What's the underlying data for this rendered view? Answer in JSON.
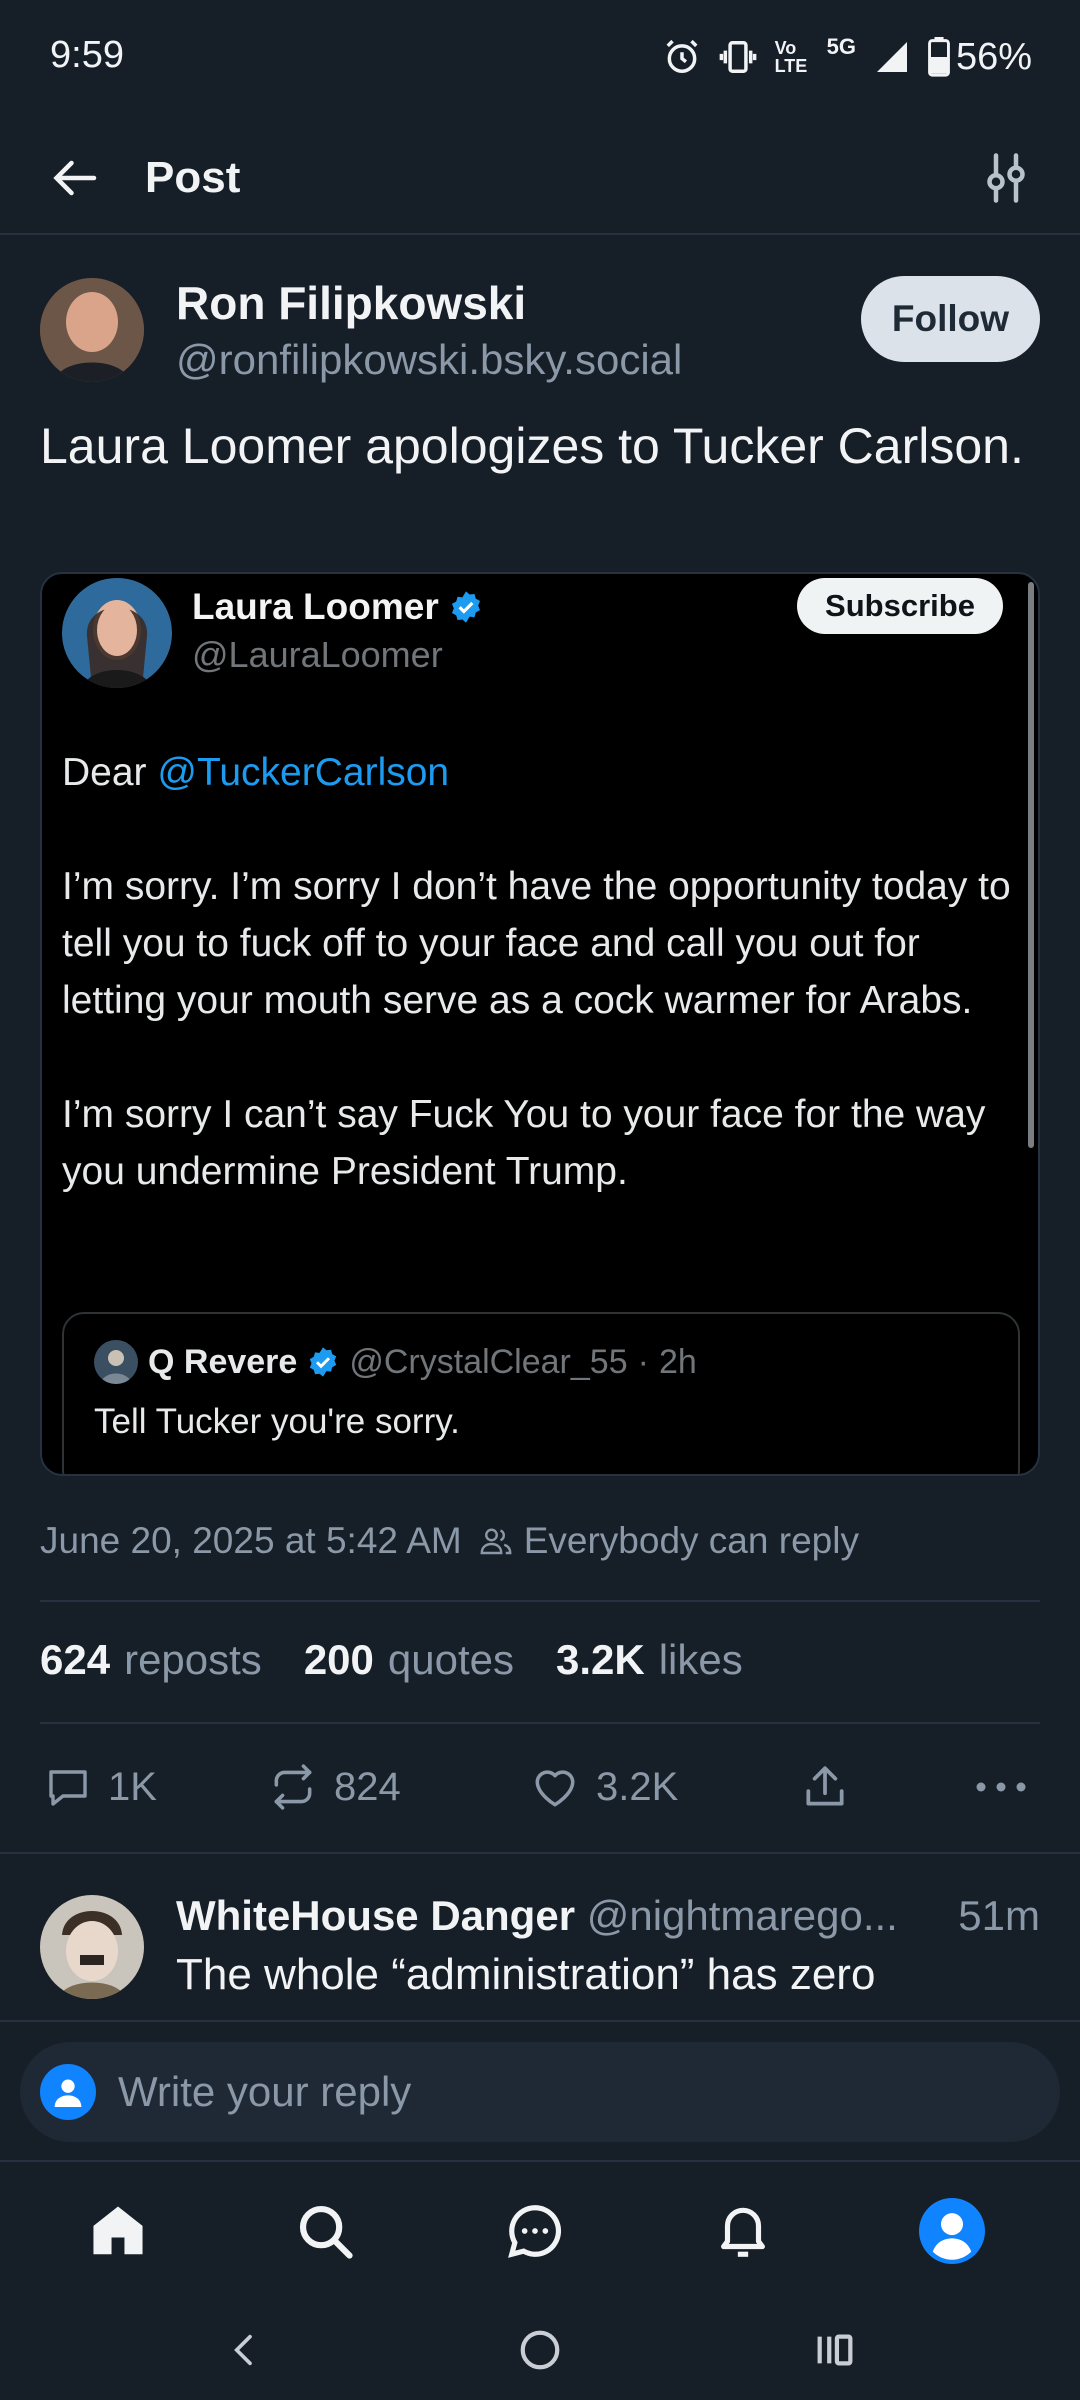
{
  "status_bar": {
    "time": "9:59",
    "network": "5G",
    "volte": "Vo LTE",
    "battery": "56%",
    "icons": [
      "alarm-icon",
      "vibrate-icon",
      "volte-icon",
      "signal-icon",
      "battery-icon"
    ]
  },
  "header": {
    "title": "Post",
    "back_icon": "arrow-left-icon",
    "filter_icon": "sliders-icon"
  },
  "post": {
    "author_name": "Ron Filipkowski",
    "author_handle": "@ronfilipkowski.bsky.social",
    "follow_label": "Follow",
    "text": "Laura Loomer apologizes to Tucker Carlson.",
    "embed": {
      "name": "Laura Loomer",
      "handle": "@LauraLoomer",
      "subscribe_label": "Subscribe",
      "greeting": "Dear",
      "mention": "@TuckerCarlson",
      "paragraph1": "I’m sorry. I’m sorry I don’t have the opportunity today to tell you to fuck off to your face and call you out for letting your mouth serve as a cock warmer for Arabs.",
      "paragraph2": "I’m sorry I can’t say Fuck You to your face for the way you undermine President Trump.",
      "quote": {
        "name": "Q Revere",
        "handle": "@CrystalClear_55",
        "separator": "·",
        "time": "2h",
        "text": "Tell Tucker you're sorry."
      }
    },
    "timestamp": "June 20, 2025 at 5:42 AM",
    "reply_permission": "Everybody can reply",
    "stats": {
      "reposts_count": "624",
      "reposts_label": "reposts",
      "quotes_count": "200",
      "quotes_label": "quotes",
      "likes_count": "3.2K",
      "likes_label": "likes"
    },
    "actions": {
      "reply_count": "1K",
      "repost_count": "824",
      "like_count": "3.2K"
    }
  },
  "reply": {
    "name": "WhiteHouse Danger",
    "handle": "@nightmarego...",
    "time": "51m",
    "text": "The whole “administration” has zero"
  },
  "composer": {
    "placeholder": "Write your reply"
  },
  "bottom_nav": {
    "items": [
      "home-icon",
      "search-icon",
      "chat-icon",
      "bell-icon",
      "profile-icon"
    ],
    "accent": "#1083fe"
  },
  "colors": {
    "background": "#161e27",
    "muted_text": "#8b98a8",
    "link": "#1d9bf0",
    "verified": "#1d9bf0"
  }
}
